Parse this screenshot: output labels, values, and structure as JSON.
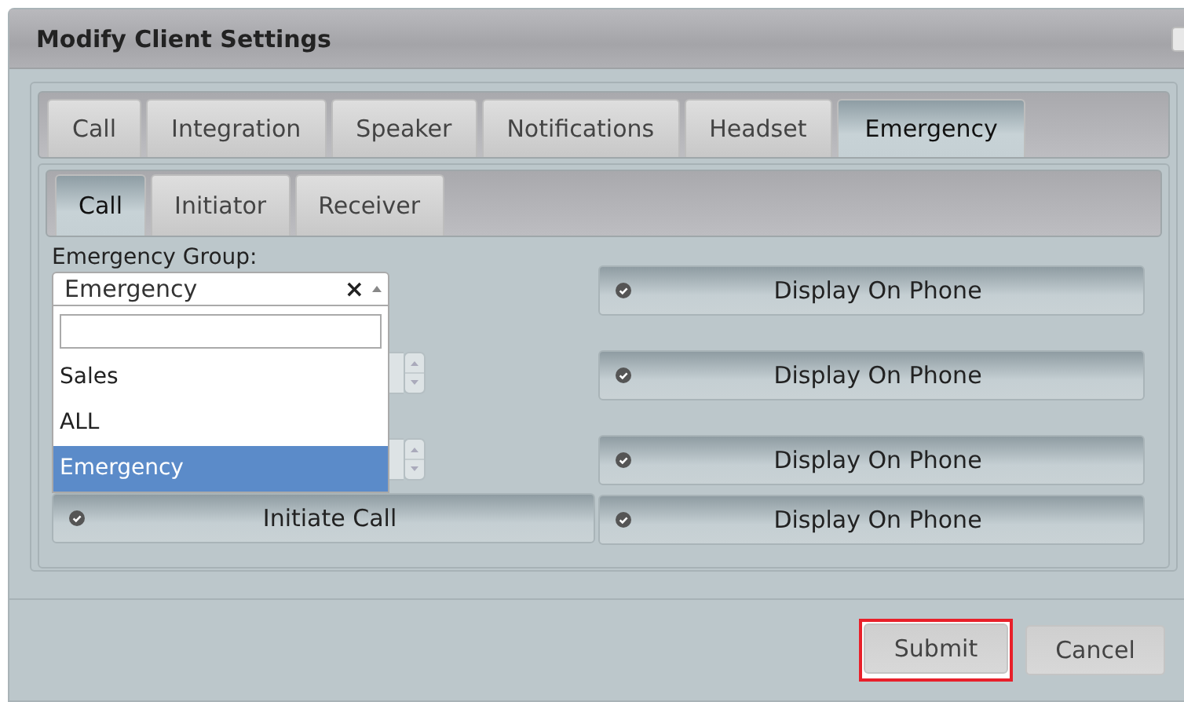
{
  "dialog": {
    "title": "Modify Client Settings"
  },
  "tabs": [
    {
      "label": "Call",
      "selected": false
    },
    {
      "label": "Integration",
      "selected": false
    },
    {
      "label": "Speaker",
      "selected": false
    },
    {
      "label": "Notifications",
      "selected": false
    },
    {
      "label": "Headset",
      "selected": false
    },
    {
      "label": "Emergency",
      "selected": true
    }
  ],
  "subtabs": [
    {
      "label": "Call",
      "selected": true
    },
    {
      "label": "Initiator",
      "selected": false
    },
    {
      "label": "Receiver",
      "selected": false
    }
  ],
  "emergency_group": {
    "label": "Emergency Group:",
    "value": "Emergency",
    "clear": "×",
    "expanded": true,
    "options": [
      {
        "label": "Sales",
        "selected": false
      },
      {
        "label": "ALL",
        "selected": false
      },
      {
        "label": "Emergency",
        "selected": true
      }
    ]
  },
  "initiate_button": {
    "label": "Initiate Call"
  },
  "display_buttons": [
    {
      "label": "Display On Phone"
    },
    {
      "label": "Display On Phone"
    },
    {
      "label": "Display On Phone"
    },
    {
      "label": "Display On Phone"
    }
  ],
  "footer_buttons": [
    {
      "label": "Submit",
      "highlighted": true
    },
    {
      "label": "Cancel",
      "highlighted": false
    }
  ]
}
